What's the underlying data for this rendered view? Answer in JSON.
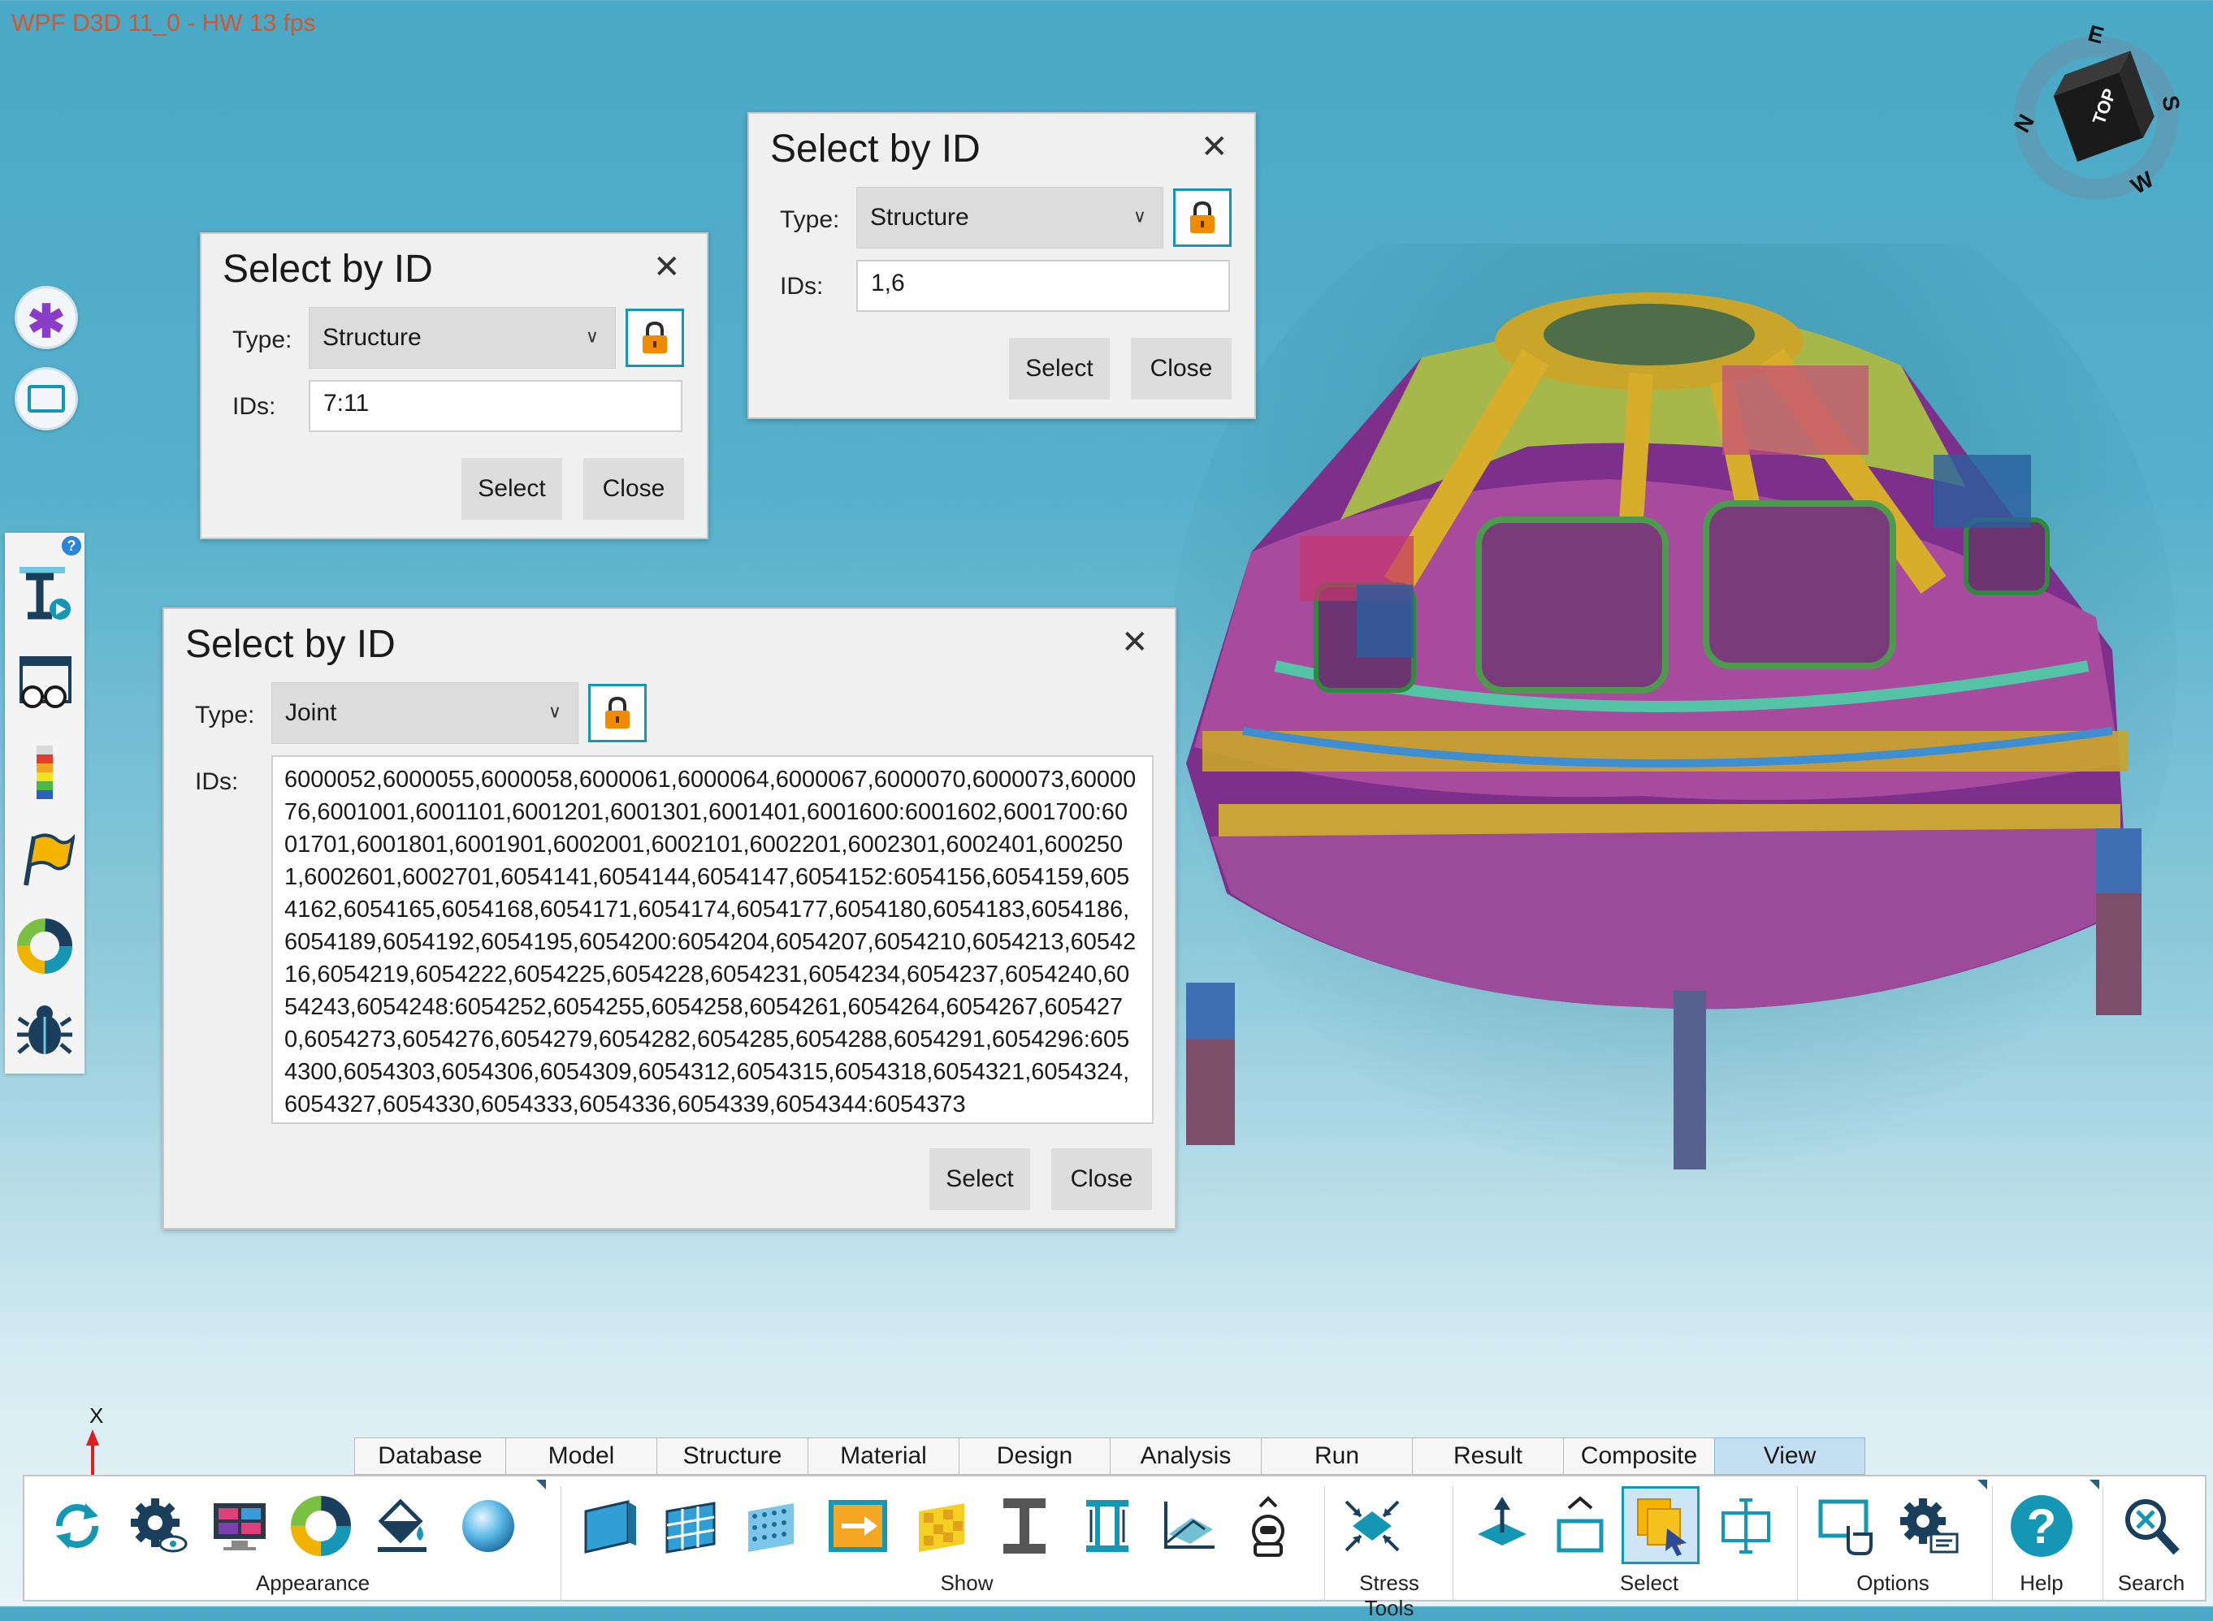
{
  "status": {
    "fps_text": "WPF D3D 11_0 - HW  13  fps"
  },
  "compass": {
    "north": "N",
    "east": "E",
    "south": "S",
    "west": "W",
    "cube_face": "TOP"
  },
  "axis": {
    "x_label": "X"
  },
  "dialogs": [
    {
      "title": "Select by ID",
      "type_label": "Type:",
      "type_value": "Structure",
      "ids_label": "IDs:",
      "ids_value": "7:11",
      "select_label": "Select",
      "close_label": "Close"
    },
    {
      "title": "Select by ID",
      "type_label": "Type:",
      "type_value": "Structure",
      "ids_label": "IDs:",
      "ids_value": "1,6",
      "select_label": "Select",
      "close_label": "Close"
    },
    {
      "title": "Select by ID",
      "type_label": "Type:",
      "type_value": "Joint",
      "ids_label": "IDs:",
      "ids_value": "6000052,6000055,6000058,6000061,6000064,6000067,6000070,6000073,6000076,6001001,6001101,6001201,6001301,6001401,6001600:6001602,6001700:6001701,6001801,6001901,6002001,6002101,6002201,6002301,6002401,6002501,6002601,6002701,6054141,6054144,6054147,6054152:6054156,6054159,6054162,6054165,6054168,6054171,6054174,6054177,6054180,6054183,6054186,6054189,6054192,6054195,6054200:6054204,6054207,6054210,6054213,6054216,6054219,6054222,6054225,6054228,6054231,6054234,6054237,6054240,6054243,6054248:6054252,6054255,6054258,6054261,6054264,6054267,6054270,6054273,6054276,6054279,6054282,6054285,6054288,6054291,6054296:6054300,6054303,6054306,6054309,6054312,6054315,6054318,6054321,6054324,6054327,6054330,6054333,6054336,6054339,6054344:6054373",
      "select_label": "Select",
      "close_label": "Close"
    }
  ],
  "help_badge": "?",
  "ribbon": {
    "tabs": [
      "Database",
      "Model",
      "Structure",
      "Material",
      "Design",
      "Analysis",
      "Run",
      "Result",
      "Composite",
      "View"
    ],
    "active_tab": "View",
    "groups": {
      "appearance": "Appearance",
      "show": "Show",
      "stress_tools": "Stress Tools",
      "select": "Select",
      "options": "Options",
      "help": "Help",
      "search": "Search"
    },
    "help_glyph": "?"
  },
  "colors": {
    "accent": "#1497b5",
    "lock": "#f08a00",
    "active_tab": "#c4dff2",
    "fps_text": "#d9542b"
  }
}
